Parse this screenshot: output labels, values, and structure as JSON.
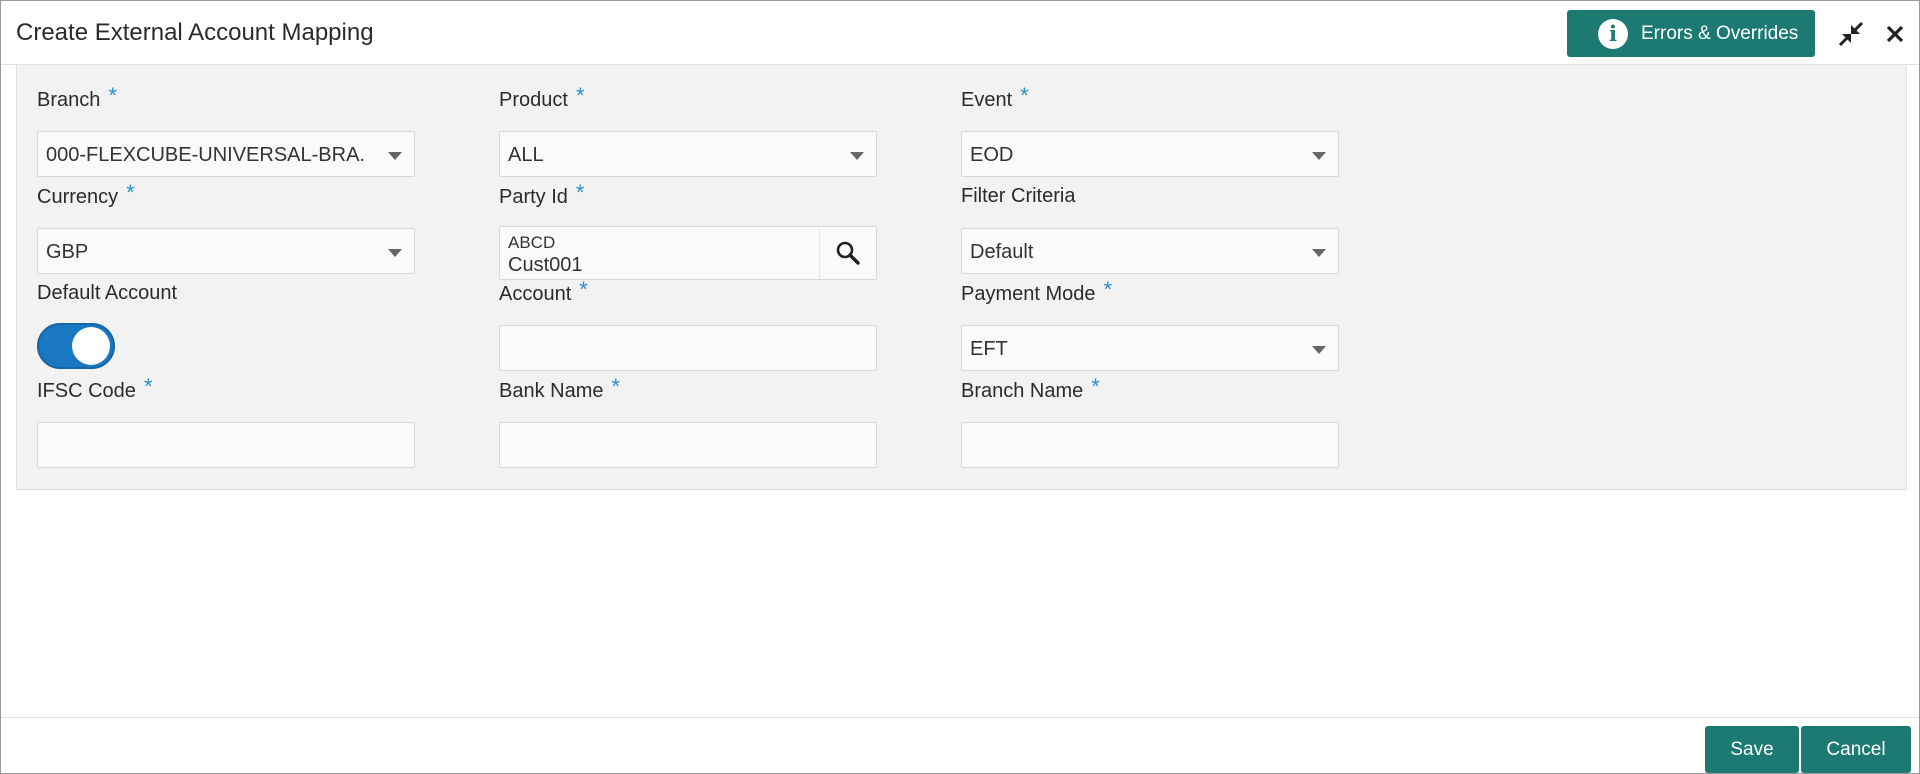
{
  "window": {
    "title": "Create External Account Mapping"
  },
  "header": {
    "errors_button_label": "Errors & Overrides",
    "icons": {
      "info": "info-icon",
      "minimize": "minimize-icon",
      "close": "close-icon"
    }
  },
  "form": {
    "required_marker": "*",
    "branch": {
      "label": "Branch",
      "value": "000-FLEXCUBE-UNIVERSAL-BRA..."
    },
    "product": {
      "label": "Product",
      "value": "ALL"
    },
    "event": {
      "label": "Event",
      "value": "EOD"
    },
    "currency": {
      "label": "Currency",
      "value": "GBP"
    },
    "party_id": {
      "label": "Party Id",
      "line1": "ABCD",
      "line2": "Cust001"
    },
    "filter_criteria": {
      "label": "Filter Criteria",
      "value": "Default"
    },
    "default_account": {
      "label": "Default Account",
      "on": true
    },
    "account": {
      "label": "Account",
      "value": ""
    },
    "payment_mode": {
      "label": "Payment Mode",
      "value": "EFT"
    },
    "ifsc_code": {
      "label": "IFSC Code",
      "value": ""
    },
    "bank_name": {
      "label": "Bank Name",
      "value": ""
    },
    "branch_name": {
      "label": "Branch Name",
      "value": ""
    }
  },
  "footer": {
    "save_label": "Save",
    "cancel_label": "Cancel"
  },
  "colors": {
    "accent": "#1d7a72",
    "toggle": "#1a78c2",
    "required": "#2a8fd1"
  }
}
